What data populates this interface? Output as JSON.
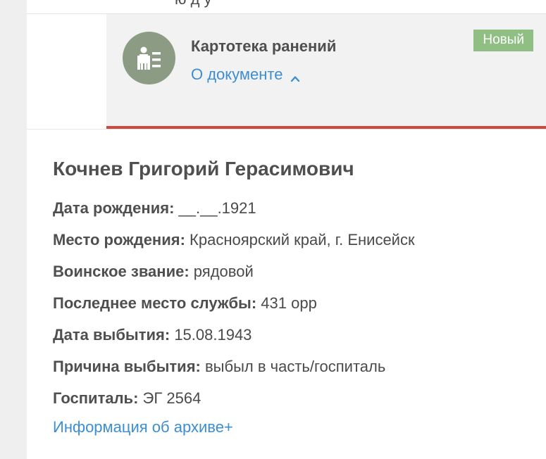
{
  "header": {
    "cut_text": "ю д у",
    "badge": "Новый",
    "doc_icon": "document-person-icon",
    "doc_title": "Картотека ранений",
    "about_link": "О документе",
    "about_chevron_icon": "chevron-up-icon"
  },
  "person": {
    "name": "Кочнев Григорий Герасимович",
    "fields": [
      {
        "label": "Дата рождения:",
        "value": "__.__.1921"
      },
      {
        "label": "Место рождения:",
        "value": "Красноярский край, г. Енисейск"
      },
      {
        "label": "Воинское звание:",
        "value": "рядовой"
      },
      {
        "label": "Последнее место службы:",
        "value": "431 орр"
      },
      {
        "label": "Дата выбытия:",
        "value": "15.08.1943"
      },
      {
        "label": "Причина выбытия:",
        "value": "выбыл в часть/госпиталь"
      },
      {
        "label": "Госпиталь:",
        "value": "ЭГ 2564"
      }
    ],
    "archive_link": "Информация об архиве+"
  },
  "colors": {
    "badge": "#8fbf82",
    "link": "#3d8ed1",
    "accent_border": "#d0493f",
    "icon_bg": "#8c9c84"
  }
}
